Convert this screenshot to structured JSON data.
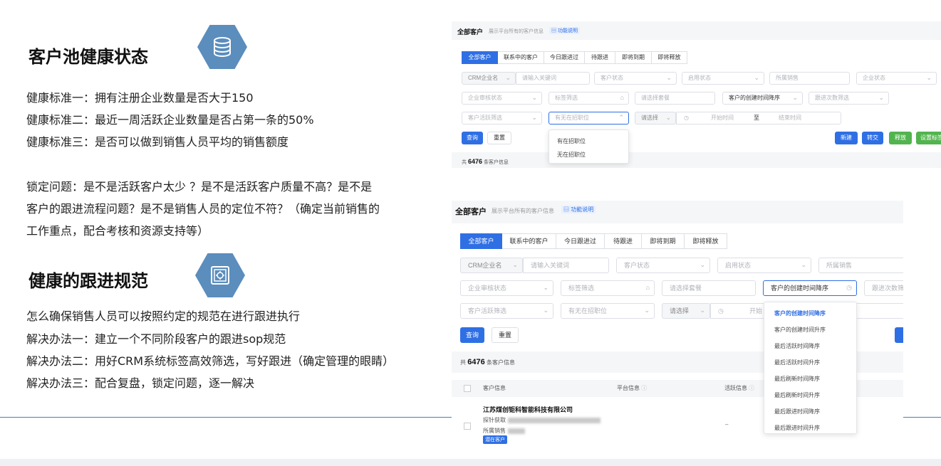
{
  "slide": {
    "section1_title": "客户池健康状态",
    "section1_lines": [
      "健康标准一：拥有注册企业数量是否大于150",
      "健康标准二：最近一周活跃企业数量是否占第一条的50%",
      "健康标准三：是否可以做到销售人员平均的销售额度"
    ],
    "problem_lines": [
      "锁定问题：是不是活跃客户太少 ？是不是活跃客户质量不高？是不是",
      "客户的跟进流程问题？是不是销售人员的定位不符？（确定当前销售的",
      "工作重点，配合考核和资源支持等）"
    ],
    "section2_title": "健康的跟进规范",
    "section2_lines": [
      "怎么确保销售人员可以按照约定的规范在进行跟进执行",
      "解决办法一：建立一个不同阶段客户的跟进sop规范",
      "解决办法二：用好CRM系统标签高效筛选，写好跟进（确定管理的眼睛）",
      "解决办法三：配合复盘，锁定问题，逐一解决"
    ],
    "icon1": "database-icon",
    "icon2": "safe-icon"
  },
  "top_panel": {
    "title": "全部客户",
    "desc": "展示平台所有的客户信息",
    "help": "功能说明",
    "tabs": [
      "全部客户",
      "联系中的客户",
      "今日跟进过",
      "待跟进",
      "即将到期",
      "即将释放"
    ],
    "crm_prefix": "CRM企业名",
    "keyword_placeholder": "请输入关键词",
    "customer_status": "客户状态",
    "enable_status": "启用状态",
    "sales_owner": "所属销售",
    "company_status": "企业状态",
    "company_review": "企业审核状态",
    "tag_filter": "标签筛选",
    "package_select": "请选择套餐",
    "sort_value": "客户的创建时间降序",
    "follow_count": "跟进次数筛选",
    "active_filter": "客户活跃筛选",
    "hiring": "有无在招职位",
    "please_select": "请选择",
    "start_time": "开始时间",
    "to": "至",
    "end_time": "结束时间",
    "search": "查询",
    "reset": "重置",
    "new": "新建",
    "transfer": "转交",
    "release": "释放",
    "set_tag": "设置标签",
    "total_prefix": "共",
    "total_count": "6476",
    "total_suffix": "条客户信息",
    "hiring_options": [
      "有在招职位",
      "无在招职位"
    ]
  },
  "bottom_panel": {
    "title": "全部客户",
    "desc": "展示平台所有的客户信息",
    "help": "功能说明",
    "tabs": [
      "全部客户",
      "联系中的客户",
      "今日跟进过",
      "待跟进",
      "即将到期",
      "即将释放"
    ],
    "crm_prefix": "CRM企业名",
    "keyword_placeholder": "请输入关键词",
    "customer_status": "客户状态",
    "enable_status": "启用状态",
    "sales_owner": "所属销售",
    "company_review": "企业审核状态",
    "tag_filter": "标签筛选",
    "package_select": "请选择套餐",
    "sort_value": "客户的创建时间降序",
    "follow_count": "跟进次数筛",
    "active_filter": "客户活跃筛选",
    "hiring": "有无在招职位",
    "please_select": "请选择",
    "start_time": "开始",
    "search": "查询",
    "reset": "重置",
    "total_prefix": "共",
    "total_count": "6476",
    "total_suffix": "条客户信息",
    "col_customer": "客户信息",
    "col_platform": "平台信息",
    "col_active": "活跃信息",
    "company_name": "江苏煤创钜科智能科技有限公司",
    "row_source": "探针获取",
    "row_sales": "所属销售",
    "row_badge": "潜在客户",
    "row_dash": "–",
    "sort_options": [
      "客户的创建时间降序",
      "客户的创建时间升序",
      "最后活跃时间降序",
      "最后活跃时间升序",
      "最后刷新时间降序",
      "最后刷新时间升序",
      "最后跟进时间降序",
      "最后跟进时间升序"
    ]
  }
}
